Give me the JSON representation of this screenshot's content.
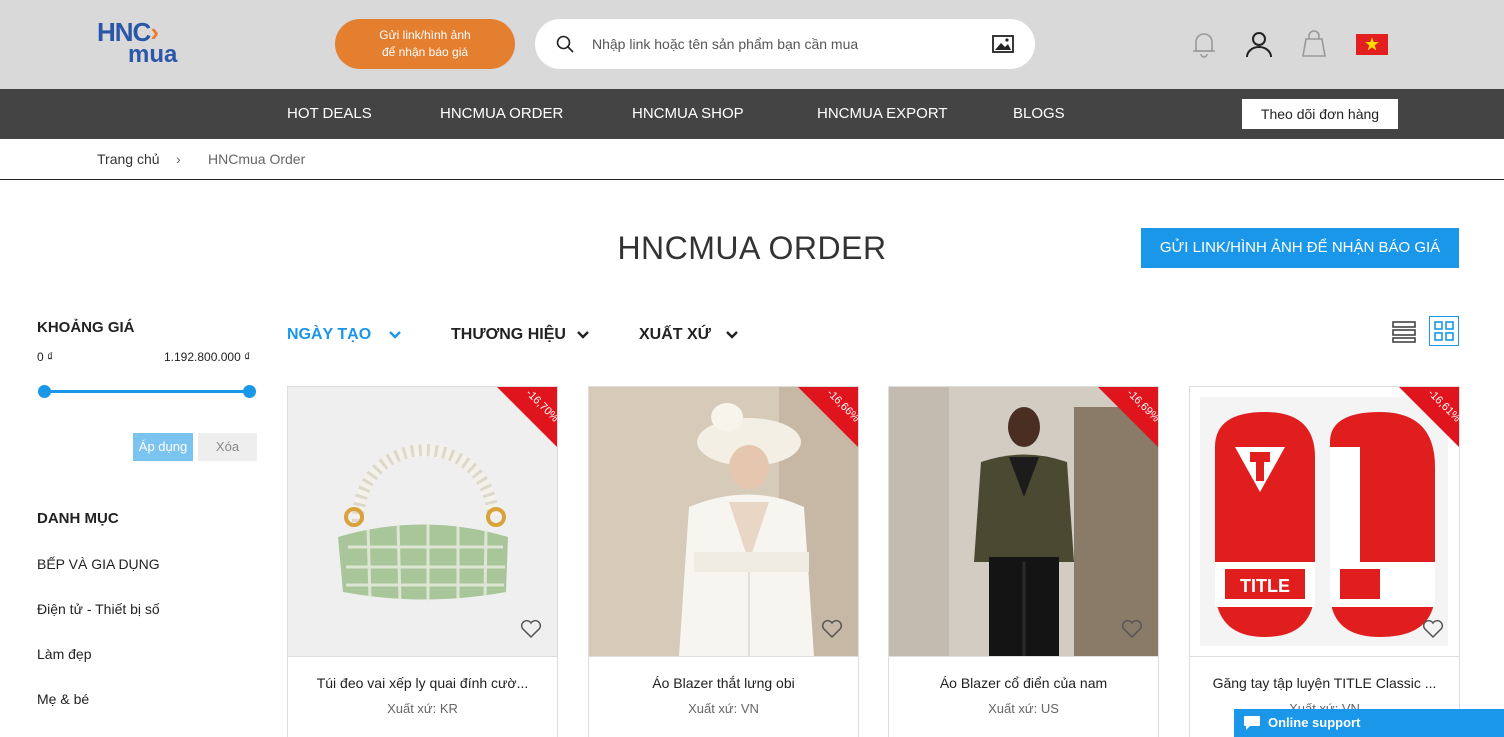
{
  "header": {
    "logo_top": "HNC",
    "logo_bottom": "mua",
    "quote_pill_line1": "Gửi link/hình ảnh",
    "quote_pill_line2": "để nhận báo giá",
    "search_placeholder": "Nhập link hoặc tên sản phẩm bạn cần mua",
    "icons": [
      "bell-icon",
      "user-icon",
      "cart-icon",
      "vietnam-flag-icon"
    ],
    "accent_color": "#e57f30"
  },
  "nav": {
    "items": [
      "HOT DEALS",
      "HNCMUA ORDER",
      "HNCMUA SHOP",
      "HNCMUA EXPORT",
      "BLOGS"
    ],
    "track_order": "Theo dõi đơn hàng"
  },
  "breadcrumb": {
    "home": "Trang chủ",
    "separator": "›",
    "current": "HNCmua Order"
  },
  "main": {
    "title": "HNCMUA ORDER",
    "send_button": "GỬI LINK/HÌNH ẢNH ĐỂ NHẬN BÁO GIÁ"
  },
  "sidebar": {
    "price_heading": "KHOẢNG GIÁ",
    "price_min": "0 ₫",
    "price_max": "1.192.800.000 ₫",
    "apply": "Áp dụng",
    "clear": "Xóa",
    "category_heading": "DANH MỤC",
    "categories": [
      "BẾP VÀ GIA DỤNG",
      "Điện tử - Thiết bị số",
      "Làm đẹp",
      "Mẹ & bé"
    ]
  },
  "filters": {
    "sort": "NGÀY TẠO",
    "brand": "THƯƠNG HIỆU",
    "origin": "XUẤT XỨ"
  },
  "products": [
    {
      "name": "Túi đeo vai xếp ly quai đính cườ...",
      "origin": "Xuất xứ: KR",
      "discount": "-16,70%"
    },
    {
      "name": "Áo Blazer thắt lưng obi",
      "origin": "Xuất xứ: VN",
      "discount": "-16,66%"
    },
    {
      "name": "Áo Blazer cổ điển của nam",
      "origin": "Xuất xứ: US",
      "discount": "-16,69%"
    },
    {
      "name": "Găng tay tập luyện TITLE Classic ...",
      "origin": "Xuất xứ: VN",
      "discount": "-16,61%",
      "print": "TITLE"
    }
  ],
  "support": {
    "label": "Online support"
  },
  "colors": {
    "primary_blue": "#1a97e8",
    "nav_bg": "#444444",
    "badge_red": "#e0141c"
  }
}
